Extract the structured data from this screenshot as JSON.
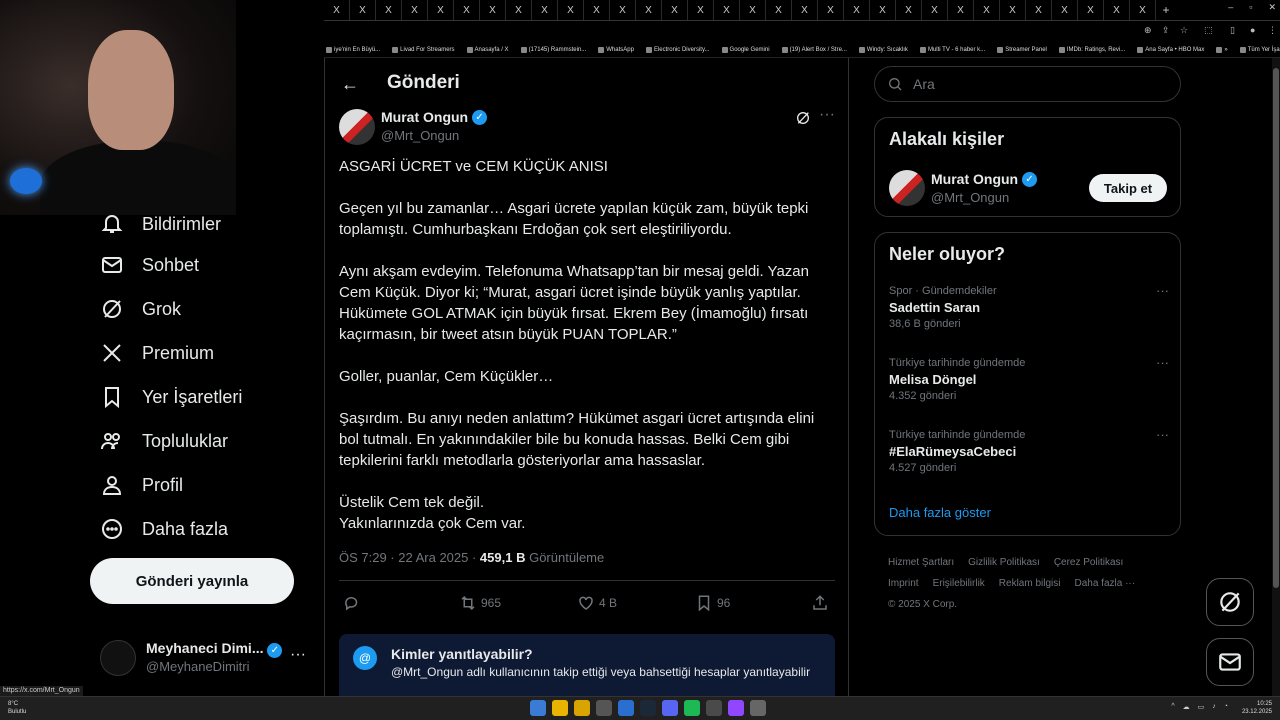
{
  "browser": {
    "tab_glyph": "X",
    "new_tab": "+",
    "window_controls": [
      "–",
      "▫",
      "✕"
    ],
    "bookmarks": [
      "iye'nin En Büyü...",
      "Livad For Streamers",
      "Anasayfa / X",
      "(17145) Rammstein...",
      "WhatsApp",
      "Electronic Diversity...",
      "Google Gemini",
      "(19) Alert Box / Stre...",
      "Windy: Sıcaklık",
      "Multi TV - 6 haber k...",
      "Streamer Panel",
      "IMDb: Ratings, Revi...",
      "Ana Sayfa • HBO Max",
      "»",
      "Tüm Yer İşaretleri"
    ]
  },
  "left_nav": {
    "items": [
      {
        "label": "Bildirimler",
        "icon": "bell-icon"
      },
      {
        "label": "Sohbet",
        "icon": "mail-icon"
      },
      {
        "label": "Grok",
        "icon": "grok-icon"
      },
      {
        "label": "Premium",
        "icon": "x-logo-icon"
      },
      {
        "label": "Yer İşaretleri",
        "icon": "bookmark-icon"
      },
      {
        "label": "Topluluklar",
        "icon": "communities-icon"
      },
      {
        "label": "Profil",
        "icon": "person-icon"
      },
      {
        "label": "Daha fazla",
        "icon": "more-circle-icon"
      }
    ],
    "post_button": "Gönderi yayınla",
    "account": {
      "name": "Meyhaneci Dimi...",
      "handle": "@MeyhaneDimitri",
      "more": "···"
    }
  },
  "status_url": "https://x.com/Mrt_Ongun",
  "main": {
    "back": "←",
    "title": "Gönderi",
    "author_name": "Murat Ongun",
    "author_handle": "@Mrt_Ongun",
    "more": "···",
    "tweet_paragraphs": [
      "ASGARİ ÜCRET ve CEM KÜÇÜK ANISI",
      "Geçen yıl bu zamanlar… Asgari ücrete yapılan küçük zam, büyük tepki toplamıştı. Cumhurbaşkanı Erdoğan çok sert eleştiriliyordu.",
      "Aynı akşam evdeyim. Telefonuma Whatsapp’tan bir mesaj geldi. Yazan Cem Küçük. Diyor ki; “Murat, asgari ücret işinde büyük yanlış yaptılar. Hükümete GOL ATMAK için büyük fırsat. Ekrem Bey (İmamoğlu) fırsatı kaçırmasın, bir tweet atsın büyük PUAN TOPLAR.”",
      "Goller, puanlar, Cem Küçükler…",
      "Şaşırdım. Bu anıyı neden anlattım? Hükümet asgari ücret artışında elini bol tutmalı. En yakınındakiler bile bu konuda hassas. Belki Cem gibi tepkilerini farklı metodlarla gösteriyorlar ama hassaslar.",
      "Üstelik Cem tek değil.\nYakınlarınızda çok Cem var."
    ],
    "time": "ÖS 7:29 · 22 Ara 2025 · ",
    "views_count": "459,1 B",
    "views_label": " Görüntüleme",
    "actions": {
      "reposts": "965",
      "likes": "4 B",
      "bookmarks": "96"
    },
    "reply_info": {
      "title": "Kimler yanıtlayabilir?",
      "desc": "@Mrt_Ongun adlı kullanıcının takip ettiği veya bahsettiği hesaplar yanıtlayabilir"
    }
  },
  "right": {
    "search_placeholder": "Ara",
    "related_title": "Alakalı kişiler",
    "related_name": "Murat Ongun",
    "related_handle": "@Mrt_Ongun",
    "follow_label": "Takip et",
    "trends_title": "Neler oluyor?",
    "trends": [
      {
        "context": "Spor · Gündemdekiler",
        "title": "Sadettin Saran",
        "count": "38,6 B gönderi"
      },
      {
        "context": "Türkiye tarihinde gündemde",
        "title": "Melisa Döngel",
        "count": "4.352 gönderi"
      },
      {
        "context": "Türkiye tarihinde gündemde",
        "title": "#ElaRümeysaCebeci",
        "count": "4.527 gönderi"
      }
    ],
    "show_more": "Daha fazla göster",
    "footer": [
      "Hizmet Şartları",
      "Gizlilik Politikası",
      "Çerez Politikası",
      "Imprint",
      "Erişilebilirlik",
      "Reklam bilgisi",
      "Daha fazla ···",
      "© 2025 X Corp."
    ]
  },
  "taskbar": {
    "weather_temp": "8°C",
    "weather_desc": "Bulutlu",
    "time": "10:25",
    "date": "23.12.2025"
  },
  "colors": {
    "accent": "#1d9bf0",
    "background": "#000000",
    "text": "#e7e9ea",
    "muted": "#71767b"
  }
}
